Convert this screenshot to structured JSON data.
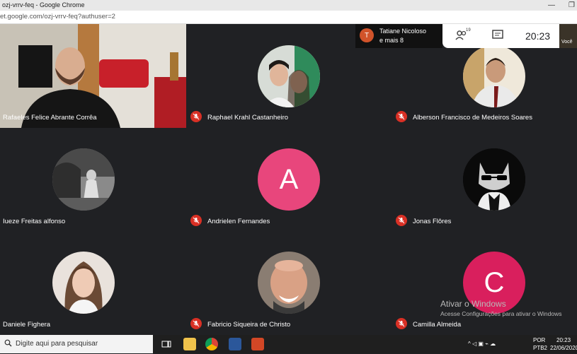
{
  "browser": {
    "title": "ozj-vrrv-feq - Google Chrome",
    "url": "et.google.com/ozj-vrrv-feq?authuser=2"
  },
  "meeting": {
    "presenter": {
      "name": "Tatiane Nicoloso",
      "more": "e mais 8",
      "initial": "T"
    },
    "participant_count": "19",
    "time": "20:23",
    "self_label": "Você"
  },
  "participants": [
    {
      "name": "Rafaeles Felice Abrante Corrêa"
    },
    {
      "name": "Raphael Krahl Castanheiro"
    },
    {
      "name": "Alberson Francisco de Medeiros Soares"
    },
    {
      "name": "Iueze Freitas alfonso"
    },
    {
      "name": "Andrielen Fernandes",
      "initial": "A",
      "color": "#e8467c"
    },
    {
      "name": "Jonas Flôres"
    },
    {
      "name": "Daniele Fighera"
    },
    {
      "name": "Fabricio Siqueira de Christo"
    },
    {
      "name": "Camilla Almeida",
      "initial": "C",
      "color": "#d91f5d"
    }
  ],
  "watermark": {
    "line1": "Ativar o Windows",
    "line2": "Acesse Configurações para ativar o Windows"
  },
  "taskbar": {
    "search_placeholder": "Digite aqui para pesquisar",
    "lang1": "POR",
    "lang2": "PTB2",
    "clock_time": "20:23",
    "clock_date": "22/06/2020"
  },
  "colors": {
    "meet_bg": "#202124",
    "mic_off": "#d93025"
  }
}
